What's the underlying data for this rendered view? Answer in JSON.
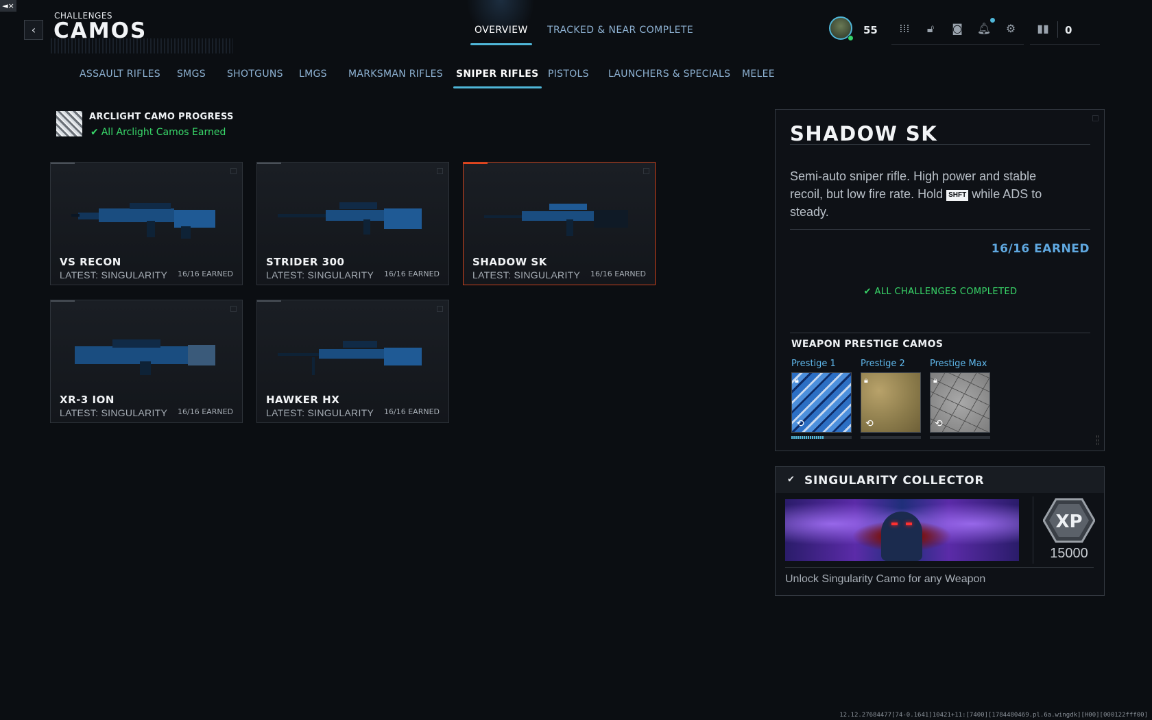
{
  "header": {
    "breadcrumb": "CHALLENGES",
    "title": "CAMOS",
    "tabs": [
      {
        "label": "OVERVIEW",
        "active": true
      },
      {
        "label": "TRACKED & NEAR COMPLETE",
        "active": false
      }
    ],
    "player_level": "55",
    "currency": "0",
    "icons": [
      "menu-grid-icon",
      "lock-icon",
      "camera-icon",
      "bell-icon",
      "gear-icon",
      "cards-icon"
    ],
    "accent_color": "#4fb6d8"
  },
  "weapon_classes": [
    {
      "label": "ASSAULT RIFLES",
      "active": false
    },
    {
      "label": "SMGS",
      "active": false
    },
    {
      "label": "SHOTGUNS",
      "active": false
    },
    {
      "label": "LMGS",
      "active": false
    },
    {
      "label": "MARKSMAN RIFLES",
      "active": false
    },
    {
      "label": "SNIPER RIFLES",
      "active": true
    },
    {
      "label": "PISTOLS",
      "active": false
    },
    {
      "label": "LAUNCHERS & SPECIALS",
      "active": false
    },
    {
      "label": "MELEE",
      "active": false
    }
  ],
  "arclight": {
    "title": "ARCLIGHT CAMO PROGRESS",
    "status": "All Arclight Camos Earned"
  },
  "weapons": [
    {
      "name": "VS RECON",
      "latest": "LATEST: SINGULARITY",
      "earned": "16/16 EARNED",
      "selected": false
    },
    {
      "name": "STRIDER 300",
      "latest": "LATEST: SINGULARITY",
      "earned": "16/16 EARNED",
      "selected": false
    },
    {
      "name": "SHADOW SK",
      "latest": "LATEST: SINGULARITY",
      "earned": "16/16 EARNED",
      "selected": true
    },
    {
      "name": "XR-3 ION",
      "latest": "LATEST: SINGULARITY",
      "earned": "16/16 EARNED",
      "selected": false
    },
    {
      "name": "HAWKER HX",
      "latest": "LATEST: SINGULARITY",
      "earned": "16/16 EARNED",
      "selected": false
    }
  ],
  "detail": {
    "title": "SHADOW SK",
    "desc_pre": "Semi-auto sniper rifle. High power and stable recoil, but low fire rate. Hold",
    "key": "SHFT",
    "desc_post": "while ADS to steady.",
    "earned": "16/16 EARNED",
    "completed": "ALL CHALLENGES COMPLETED",
    "prestige_heading": "WEAPON PRESTIGE CAMOS",
    "prestige": [
      {
        "label": "Prestige 1",
        "progress": 0.55
      },
      {
        "label": "Prestige 2",
        "progress": 0
      },
      {
        "label": "Prestige Max",
        "progress": 0
      }
    ]
  },
  "collector": {
    "title": "SINGULARITY COLLECTOR",
    "xp_label": "XP",
    "xp": "15000",
    "description": "Unlock Singularity Camo for any Weapon"
  },
  "build_string": "12.12.27684477[74-0.1641]10421+11:[7400][1784480469.pl.6a.wingdk][H00][000122fff00]"
}
